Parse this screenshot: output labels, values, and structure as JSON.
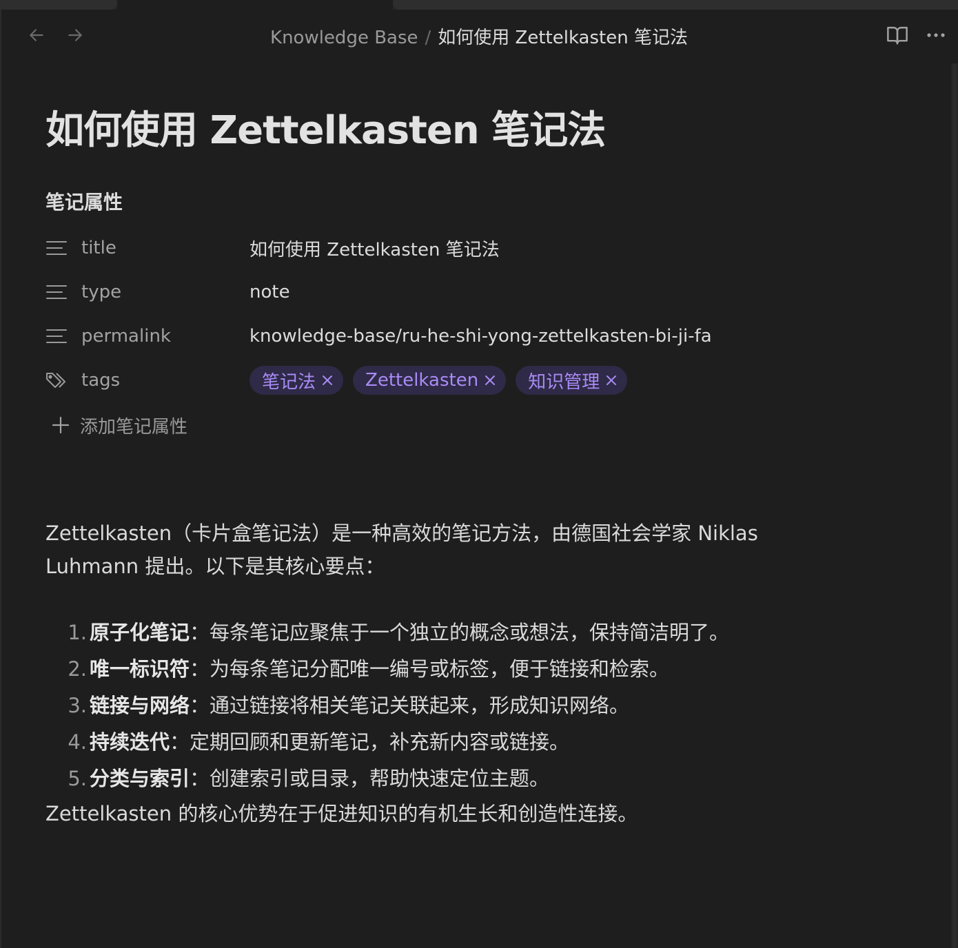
{
  "breadcrumb": {
    "root": "Knowledge Base",
    "separator": "/",
    "current": "如何使用 Zettelkasten 笔记法"
  },
  "toolbar": {
    "back_icon": "arrow-left-icon",
    "forward_icon": "arrow-right-icon",
    "reading_icon": "book-open-icon",
    "more_icon": "more-horizontal-icon"
  },
  "note": {
    "title": "如何使用 Zettelkasten 笔记法"
  },
  "properties": {
    "heading": "笔记属性",
    "title": {
      "key": "title",
      "value": "如何使用 Zettelkasten 笔记法",
      "icon": "text-lines-icon"
    },
    "type": {
      "key": "type",
      "value": "note",
      "icon": "text-lines-icon"
    },
    "permalink": {
      "key": "permalink",
      "value": "knowledge-base/ru-he-shi-yong-zettelkasten-bi-ji-fa",
      "icon": "text-lines-icon"
    },
    "tags": {
      "key": "tags",
      "icon": "tags-icon",
      "items": [
        "笔记法",
        "Zettelkasten",
        "知识管理"
      ],
      "tag_color": "#a98bf5",
      "tag_bg": "#2f2a47"
    },
    "add_label": "添加笔记属性"
  },
  "body": {
    "intro": "Zettelkasten（卡片盒笔记法）是一种高效的笔记方法，由德国社会学家 Niklas Luhmann 提出。以下是其核心要点：",
    "points": [
      {
        "num": "1.",
        "lead": "原子化笔记",
        "text": "：每条笔记应聚焦于一个独立的概念或想法，保持简洁明了。"
      },
      {
        "num": "2.",
        "lead": "唯一标识符",
        "text": "：为每条笔记分配唯一编号或标签，便于链接和检索。"
      },
      {
        "num": "3.",
        "lead": "链接与网络",
        "text": "：通过链接将相关笔记关联起来，形成知识网络。"
      },
      {
        "num": "4.",
        "lead": "持续迭代",
        "text": "：定期回顾和更新笔记，补充新内容或链接。"
      },
      {
        "num": "5.",
        "lead": "分类与索引",
        "text": "：创建索引或目录，帮助快速定位主题。"
      }
    ],
    "conclusion": "Zettelkasten 的核心优势在于促进知识的有机生长和创造性连接。"
  }
}
